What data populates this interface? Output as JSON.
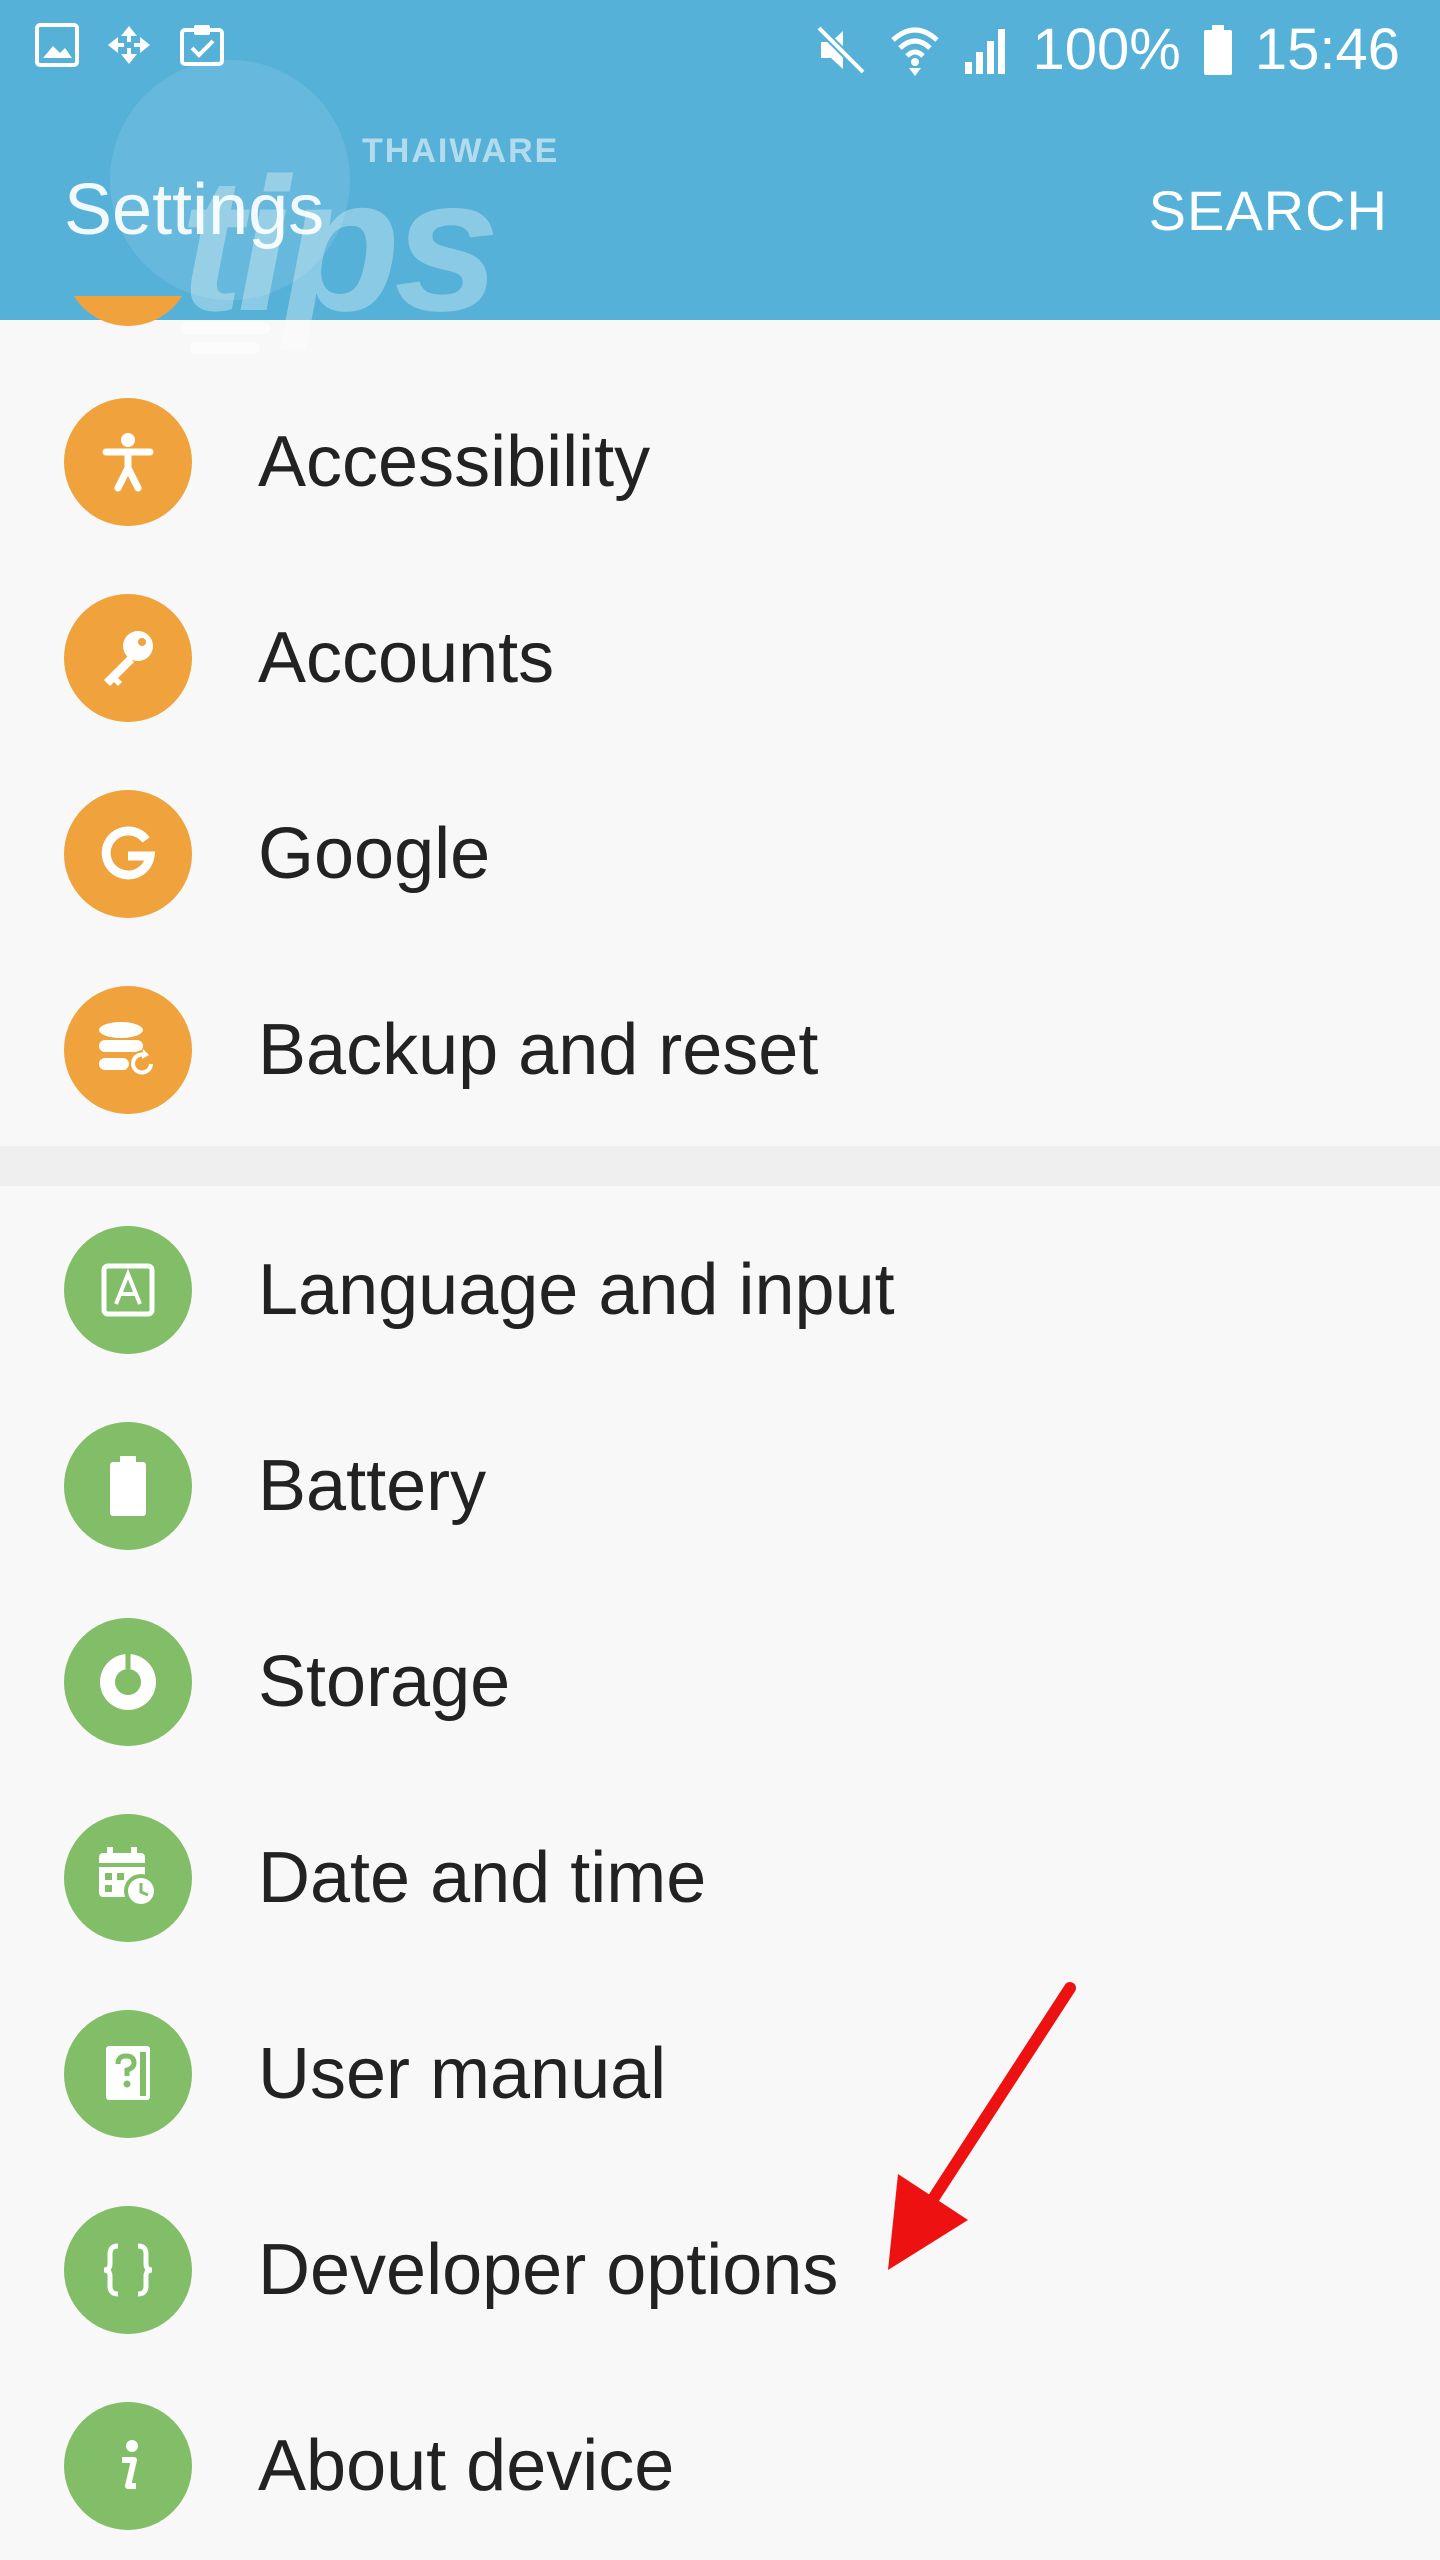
{
  "status_bar": {
    "battery_percent": "100%",
    "time": "15:46",
    "left_icons": [
      "gallery-icon",
      "sync-icon",
      "clipboard-check-icon"
    ],
    "right_icons": [
      "mute-icon",
      "wifi-icon",
      "signal-icon",
      "battery-icon"
    ]
  },
  "app_bar": {
    "title": "Settings",
    "search_label": "SEARCH",
    "color": "#55b1d8"
  },
  "watermark": {
    "brand": "THAIWARE",
    "word": "tips"
  },
  "list": {
    "group_personal": [
      {
        "label": "Accessibility",
        "icon": "accessibility-icon",
        "color": "#f0a33c"
      },
      {
        "label": "Accounts",
        "icon": "key-icon",
        "color": "#f0a33c"
      },
      {
        "label": "Google",
        "icon": "google-icon",
        "color": "#f0a33c"
      },
      {
        "label": "Backup and reset",
        "icon": "backup-icon",
        "color": "#f0a33c"
      }
    ],
    "group_system": [
      {
        "label": "Language and input",
        "icon": "language-icon",
        "color": "#82bd68"
      },
      {
        "label": "Battery",
        "icon": "battery-icon",
        "color": "#82bd68"
      },
      {
        "label": "Storage",
        "icon": "storage-icon",
        "color": "#82bd68"
      },
      {
        "label": "Date and time",
        "icon": "calendar-clock-icon",
        "color": "#82bd68"
      },
      {
        "label": "User manual",
        "icon": "help-book-icon",
        "color": "#82bd68"
      },
      {
        "label": "Developer options",
        "icon": "braces-icon",
        "color": "#82bd68"
      },
      {
        "label": "About device",
        "icon": "info-icon",
        "color": "#82bd68"
      }
    ]
  },
  "annotation": {
    "arrow_color": "#ee1111",
    "target": "Developer options"
  }
}
